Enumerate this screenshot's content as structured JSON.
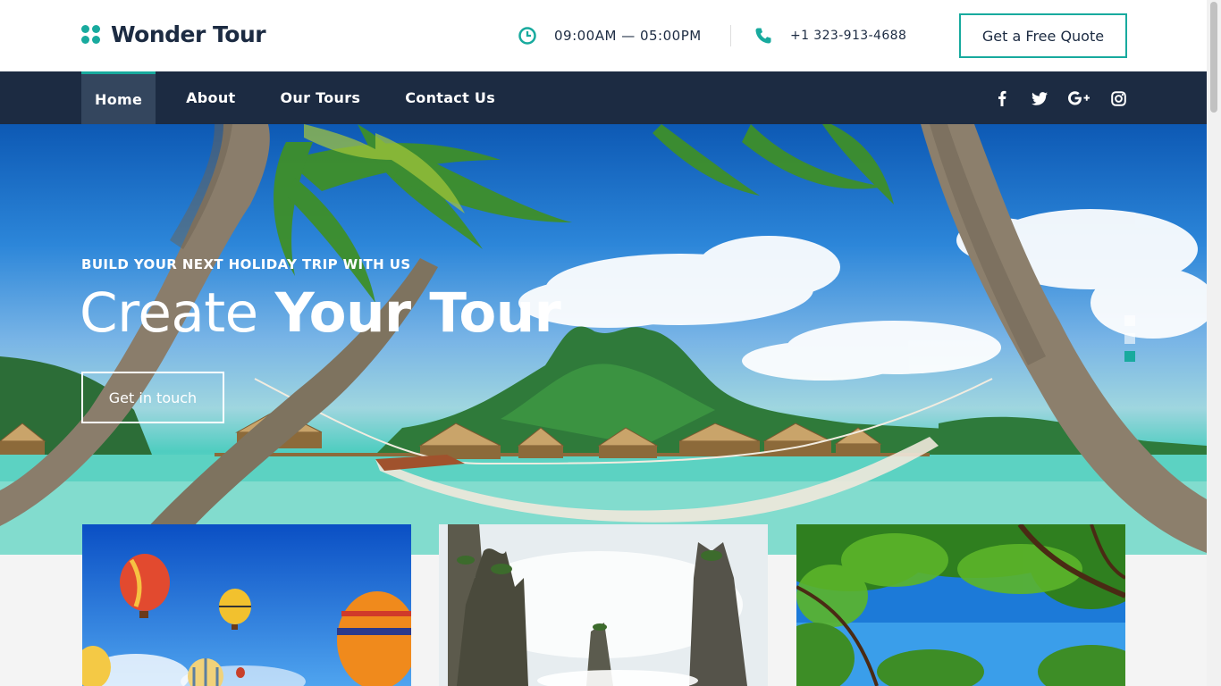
{
  "brand": {
    "name": "Wonder Tour",
    "accent": "#18aa9e",
    "navy": "#1c2b42"
  },
  "header": {
    "hours": "09:00AM — 05:00PM",
    "phone": "+1 323-913-4688",
    "quote_label": "Get a Free Quote"
  },
  "nav": {
    "items": [
      {
        "label": "Home",
        "active": true
      },
      {
        "label": "About",
        "active": false
      },
      {
        "label": "Our Tours",
        "active": false
      },
      {
        "label": "Contact Us",
        "active": false
      }
    ],
    "social": [
      "facebook-icon",
      "twitter-icon",
      "google-plus-icon",
      "instagram-icon"
    ]
  },
  "hero": {
    "subtitle": "BUILD YOUR NEXT HOLIDAY TRIP WITH US",
    "title_light": "Create",
    "title_bold": "Your Tour",
    "cta_label": "Get in touch",
    "slides": 3,
    "active_slide": 3
  },
  "cards": [
    {
      "image": "hot-air-balloons"
    },
    {
      "image": "stone-pillar-mountains"
    },
    {
      "image": "tropical-tree-canopy"
    }
  ]
}
